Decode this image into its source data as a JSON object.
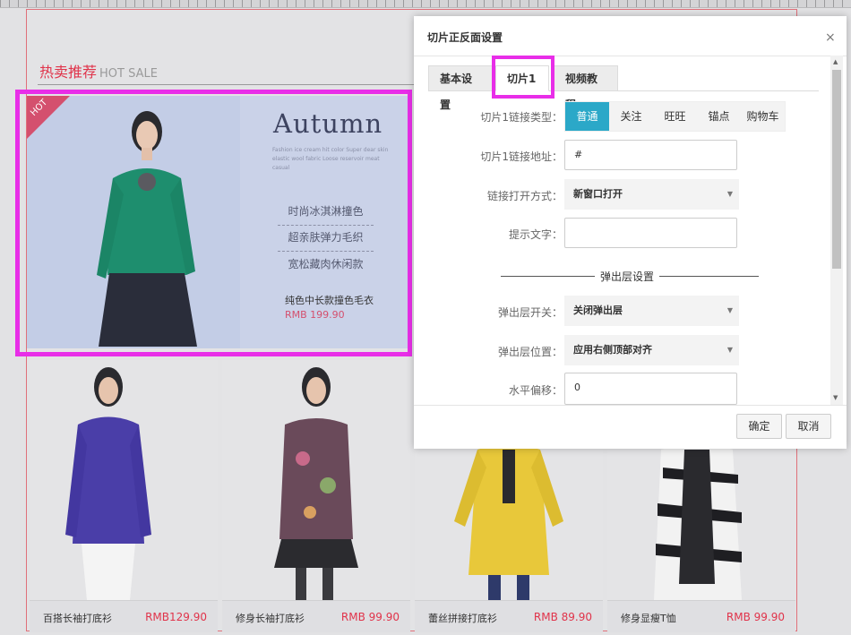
{
  "section": {
    "title": "热卖推荐",
    "title_en": "HOT SALE"
  },
  "banner": {
    "badge": "HOT",
    "heading": "Autumn",
    "subtitle": "Fashion ice cream hit color Super dear skin elastic wool fabric Loose reservoir meat casual",
    "features": [
      "时尚冰淇淋撞色",
      "超亲肤弹力毛织",
      "宽松藏肉休闲款"
    ],
    "product_name": "纯色中长款撞色毛衣",
    "price": "RMB 199.90"
  },
  "products": [
    {
      "name": "百搭长袖打底衫",
      "price": "RMB129.90",
      "color": "purple"
    },
    {
      "name": "修身长袖打底衫",
      "price": "RMB 99.90",
      "color": "floral"
    },
    {
      "name": "蕾丝拼接打底衫",
      "price": "RMB  89.90",
      "color": "yellow"
    },
    {
      "name": "修身显瘦T恤",
      "price": "RMB 99.90",
      "color": "stripe"
    }
  ],
  "dialog": {
    "title": "切片正反面设置",
    "close": "×",
    "tabs": [
      "基本设置",
      "切片1",
      "视频教程"
    ],
    "link_type_label": "切片1链接类型：",
    "link_types": [
      "普通",
      "关注",
      "旺旺",
      "锚点",
      "购物车"
    ],
    "link_url_label": "切片1链接地址：",
    "link_url_value": "#",
    "open_mode_label": "链接打开方式：",
    "open_mode_value": "新窗口打开",
    "tip_label": "提示文字：",
    "tip_value": "",
    "popup_section": "弹出层设置",
    "popup_switch_label": "弹出层开关：",
    "popup_switch_value": "关闭弹出层",
    "popup_pos_label": "弹出层位置：",
    "popup_pos_value": "应用右侧顶部对齐",
    "hoffset_label": "水平偏移：",
    "hoffset_value": "0",
    "ok": "确定",
    "cancel": "取消"
  },
  "colors": {
    "accent": "#2ba8c8",
    "highlight": "#e82ee8",
    "price": "#e0334a"
  }
}
